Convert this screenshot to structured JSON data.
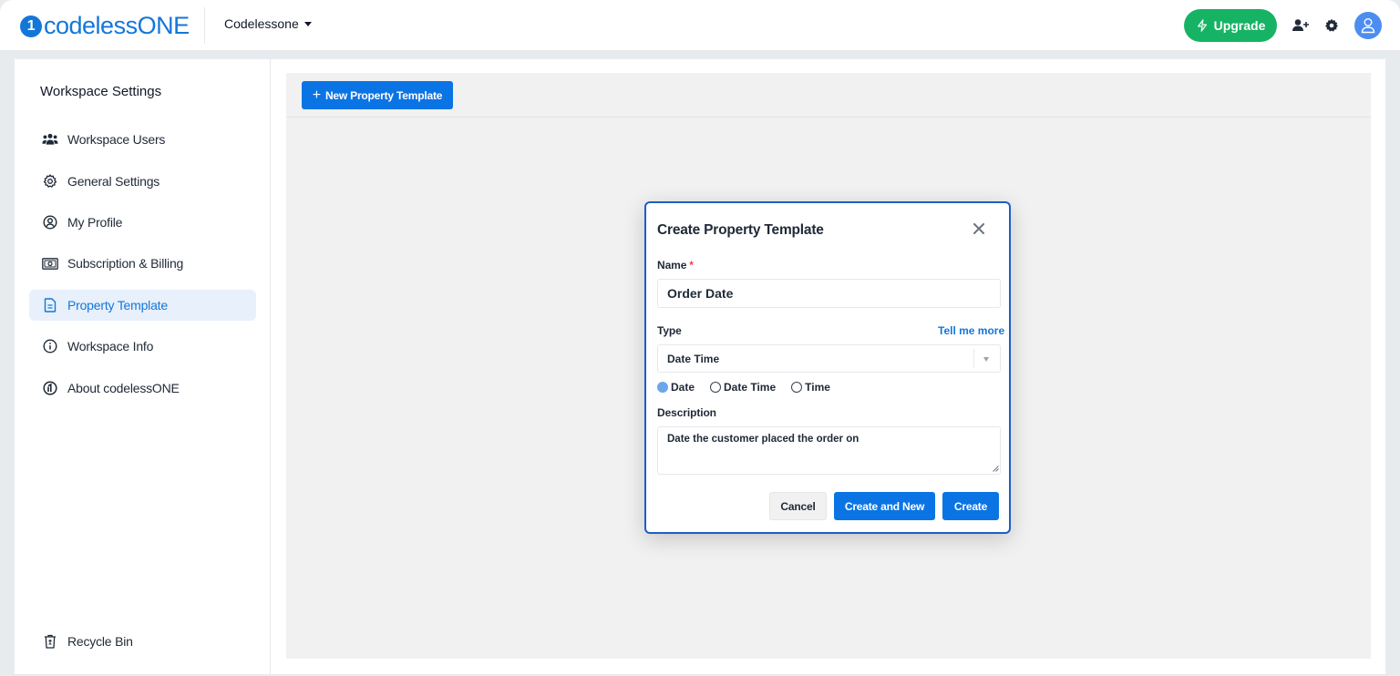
{
  "brand": {
    "logo_prefix": "codeless",
    "logo_suffix": "ONE",
    "accent": "#1476d9"
  },
  "topbar": {
    "workspace_name": "Codelessone",
    "upgrade_label": "Upgrade",
    "upgrade_color": "#16b364",
    "icons": [
      "add-user-icon",
      "gear-icon",
      "user-avatar-icon"
    ]
  },
  "sidebar": {
    "title": "Workspace Settings",
    "items": [
      {
        "label": "Workspace Users",
        "icon": "users-icon"
      },
      {
        "label": "General Settings",
        "icon": "gear-icon"
      },
      {
        "label": "My Profile",
        "icon": "user-circle-icon"
      },
      {
        "label": "Subscription & Billing",
        "icon": "banknote-icon"
      },
      {
        "label": "Property Template",
        "icon": "document-icon",
        "active": true
      },
      {
        "label": "Workspace Info",
        "icon": "info-icon"
      },
      {
        "label": "About codelessONE",
        "icon": "codeless-logo-icon"
      }
    ],
    "recycle_bin": {
      "label": "Recycle Bin",
      "icon": "recycle-bin-icon"
    }
  },
  "main": {
    "new_button_label": "New Property Template"
  },
  "modal": {
    "title": "Create Property Template",
    "name_label": "Name",
    "name_required": "*",
    "name_value": "Order Date",
    "type_label": "Type",
    "tell_me_more": "Tell me more",
    "type_value": "Date Time",
    "radio_options": [
      {
        "label": "Date",
        "selected": true
      },
      {
        "label": "Date Time",
        "selected": false
      },
      {
        "label": "Time",
        "selected": false
      }
    ],
    "description_label": "Description",
    "description_value": "Date the customer placed the order on",
    "cancel_label": "Cancel",
    "create_new_label": "Create and New",
    "create_label": "Create"
  }
}
